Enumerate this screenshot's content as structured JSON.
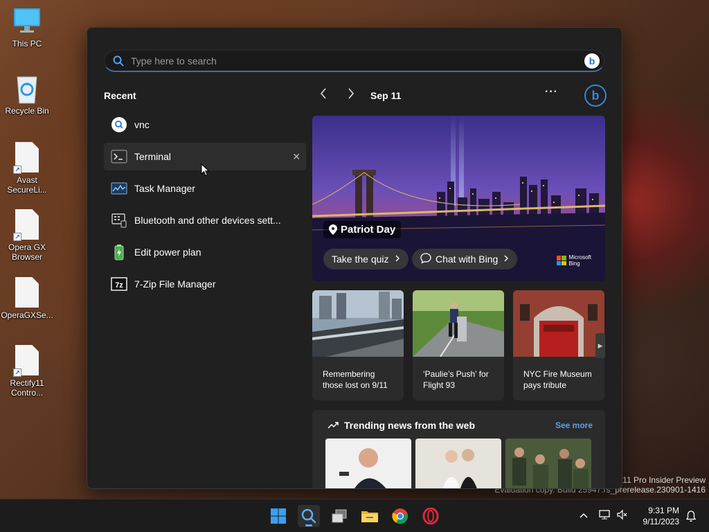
{
  "desktop": {
    "icons": [
      {
        "label": "This PC"
      },
      {
        "label": "Recycle Bin"
      },
      {
        "label": "Avast SecureLi..."
      },
      {
        "label": "Opera GX Browser"
      },
      {
        "label": "OperaGXSe..."
      },
      {
        "label": "Rectify11 Contro..."
      }
    ]
  },
  "search": {
    "placeholder": "Type here to search",
    "value": ""
  },
  "recent": {
    "title": "Recent",
    "items": [
      {
        "label": "vnc",
        "icon": "search-icon"
      },
      {
        "label": "Terminal",
        "icon": "terminal-icon"
      },
      {
        "label": "Task Manager",
        "icon": "task-manager-icon"
      },
      {
        "label": "Bluetooth and other devices sett...",
        "icon": "bluetooth-settings-icon"
      },
      {
        "label": "Edit power plan",
        "icon": "power-plan-icon"
      },
      {
        "label": "7-Zip File Manager",
        "icon": "7zip-icon"
      }
    ],
    "remove_glyph": "✕"
  },
  "highlights": {
    "date": "Sep 11",
    "more_glyph": "···",
    "hero": {
      "title": "Patriot Day",
      "quiz_label": "Take the quiz",
      "chat_label": "Chat with Bing",
      "brand_line1": "Microsoft",
      "brand_line2": "Bing"
    },
    "cards": [
      {
        "caption": "Remembering those lost on 9/11"
      },
      {
        "caption": "‘Paulie’s Push’ for Flight 93"
      },
      {
        "caption": "NYC Fire Museum pays tribute"
      }
    ]
  },
  "trending": {
    "title": "Trending news from the web",
    "see_more": "See more"
  },
  "watermark": {
    "line1": "s 11 Pro Insider Preview",
    "line2": "Evaluation copy. Build 25947.rs_prerelease.230901-1416"
  },
  "taskbar": {
    "apps": [
      "start-icon",
      "search-icon",
      "task-view-icon",
      "file-explorer-icon",
      "chrome-icon",
      "opera-icon"
    ],
    "clock_time": "9:31 PM",
    "clock_date": "9/11/2023"
  }
}
